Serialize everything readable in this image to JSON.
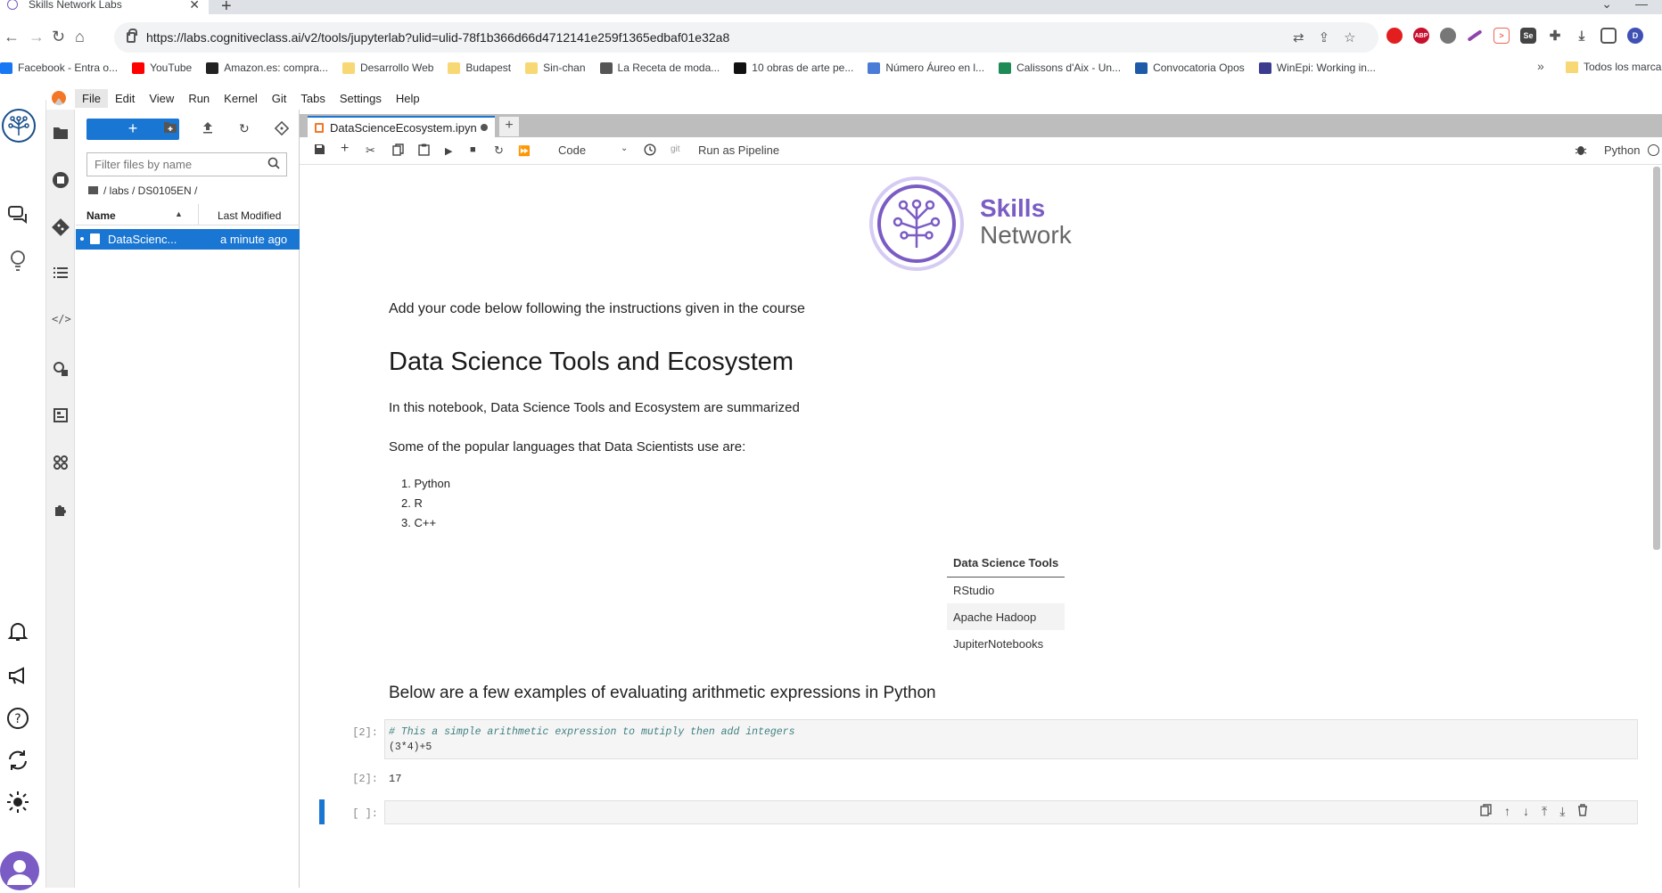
{
  "browser": {
    "tab_title": "Skills Network Labs",
    "new_tab": "+",
    "url": "https://labs.cognitiveclass.ai/v2/tools/jupyterlab?ulid=ulid-78f1b366d66d4712141e259f1365edbaf01e32a8"
  },
  "bookmarks": [
    {
      "label": "Facebook - Entra o...",
      "color": "#1877f2"
    },
    {
      "label": "YouTube",
      "color": "#ff0000"
    },
    {
      "label": "Amazon.es: compra...",
      "color": "#222222"
    },
    {
      "label": "Desarrollo Web",
      "color": "folder"
    },
    {
      "label": "Budapest",
      "color": "folder"
    },
    {
      "label": "Sin-chan",
      "color": "folder"
    },
    {
      "label": "La Receta de moda...",
      "color": "#555555"
    },
    {
      "label": "10 obras de arte pe...",
      "color": "#111111"
    },
    {
      "label": "Número Áureo en l...",
      "color": "#4a7bd6"
    },
    {
      "label": "Calissons d'Aix - Un...",
      "color": "#1e8a55"
    },
    {
      "label": "Convocatoria Opos",
      "color": "#1e5aa8"
    },
    {
      "label": "WinEpi: Working in...",
      "color": "#3b3b8f"
    }
  ],
  "bookmarks_all": "Todos los marca",
  "menu": [
    "File",
    "Edit",
    "View",
    "Run",
    "Kernel",
    "Git",
    "Tabs",
    "Settings",
    "Help"
  ],
  "filebrowser": {
    "filter_placeholder": "Filter files by name",
    "breadcrumb": "/ labs / DS0105EN /",
    "col_name": "Name",
    "col_modified": "Last Modified",
    "file_name": "DataScienc...",
    "file_modified": "a minute ago"
  },
  "notebook_tab": "DataScienceEcosystem.ipyn",
  "toolbar": {
    "cell_type": "Code",
    "git_label": "git",
    "pipeline": "Run as Pipeline",
    "kernel": "Python"
  },
  "content": {
    "logo_top": "Skills",
    "logo_bottom": "Network",
    "intro": "Add your code below following the instructions given in the course",
    "title": "Data Science Tools and Ecosystem",
    "summary": "In this notebook, Data Science Tools and Ecosystem are summarized",
    "languages_intro": "Some of the popular languages that Data Scientists use are:",
    "languages": [
      "Python",
      "R",
      "C++"
    ],
    "tools_header": "Data Science Tools",
    "tools": [
      "RStudio",
      "Apache Hadoop",
      "JupiterNotebooks"
    ],
    "examples_heading": "Below are a few examples of evaluating arithmetic expressions in Python",
    "cell1_prompt": "[2]:",
    "cell1_comment": "# This a simple arithmetic expression to mutiply then add integers",
    "cell1_code": "(3*4)+5",
    "out1_prompt": "[2]:",
    "out1_value": "17",
    "cell2_prompt": "[ ]:"
  },
  "colors": {
    "accent": "#1976d2",
    "brand": "#7a5cc4"
  }
}
